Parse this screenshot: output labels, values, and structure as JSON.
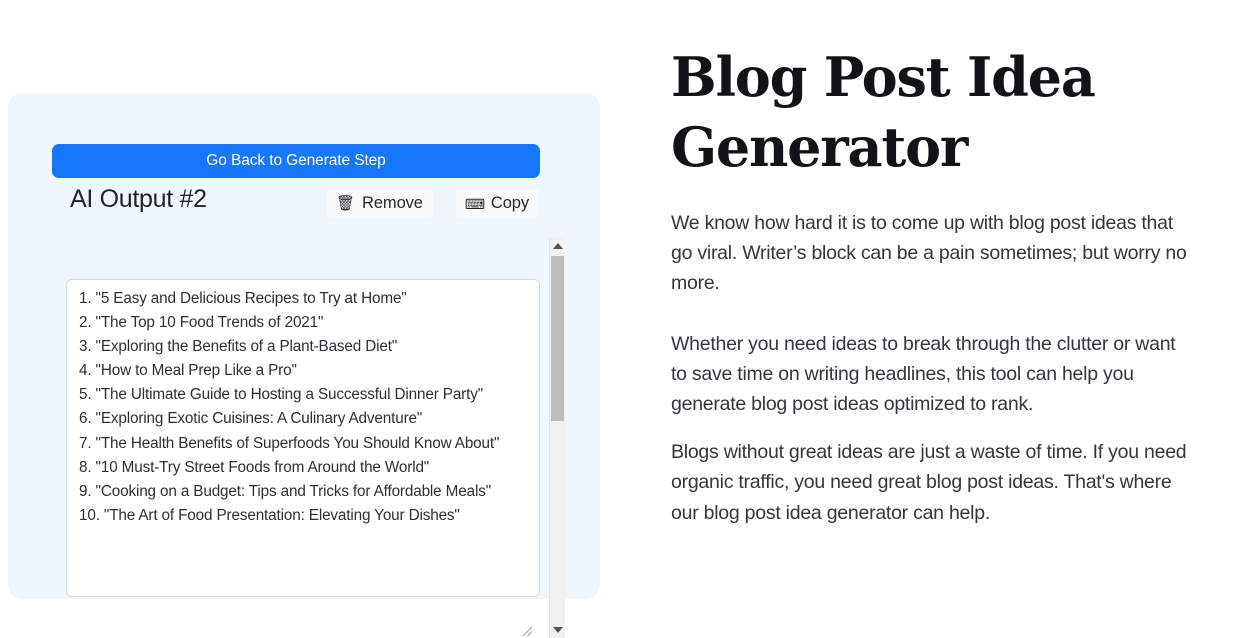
{
  "left_panel": {
    "generate_button_label": "Go Back to Generate Step",
    "output_title": "AI Output #2",
    "remove_label": "Remove",
    "remove_icon": "trash-icon",
    "remove_glyph": "🗑",
    "copy_label": "Copy",
    "copy_icon": "keyboard-icon",
    "copy_glyph": "⌨",
    "output_text": "1. \"5 Easy and Delicious Recipes to Try at Home\"\n2. \"The Top 10 Food Trends of 2021\"\n3. \"Exploring the Benefits of a Plant-Based Diet\"\n4. \"How to Meal Prep Like a Pro\"\n5. \"The Ultimate Guide to Hosting a Successful Dinner Party\"\n6. \"Exploring Exotic Cuisines: A Culinary Adventure\"\n7. \"The Health Benefits of Superfoods You Should Know About\"\n8. \"10 Must-Try Street Foods from Around the World\"\n9. \"Cooking on a Budget: Tips and Tricks for Affordable Meals\"\n10. \"The Art of Food Presentation: Elevating Your Dishes\"",
    "output_items": [
      "1. \"5 Easy and Delicious Recipes to Try at Home\"",
      "2. \"The Top 10 Food Trends of 2021\"",
      "3. \"Exploring the Benefits of a Plant-Based Diet\"",
      "4. \"How to Meal Prep Like a Pro\"",
      "5. \"The Ultimate Guide to Hosting a Successful Dinner Party\"",
      "6. \"Exploring Exotic Cuisines: A Culinary Adventure\"",
      "7. \"The Health Benefits of Superfoods You Should Know About\"",
      "8. \"10 Must-Try Street Foods from Around the World\"",
      "9. \"Cooking on a Budget: Tips and Tricks for Affordable Meals\"",
      "10. \"The Art of Food Presentation: Elevating Your Dishes\""
    ],
    "panel_background_color": "#eff7fd",
    "button_color": "#1677fb"
  },
  "right_column": {
    "heading": "Blog Post Idea Generator",
    "paragraphs": [
      "We know how hard it is to come up with blog post ideas that go viral. Writer’s block can be a pain sometimes; but worry no more.",
      "Whether you need ideas to break through the clutter or want to save time on writing headlines, this tool can help you generate blog post ideas optimized to rank.",
      "Blogs without great ideas are just a waste of time. If you need organic traffic, you need great blog post ideas. That's where our blog post idea generator can help."
    ],
    "paragraph_1": "We know how hard it is to come up with blog post ideas that go viral. Writer’s block can be a pain sometimes; but worry no more.",
    "paragraph_2": "Whether you need ideas to break through the clutter or want to save time on writing headlines, this tool can help you generate blog post ideas optimized to rank.",
    "paragraph_3": "Blogs without great ideas are just a waste of time. If you need organic traffic, you need great blog post ideas. That's where our blog post idea generator can help."
  },
  "scrollbar": {
    "up_arrow_icon": "chevron-up-icon",
    "down_arrow_icon": "chevron-down-icon"
  }
}
